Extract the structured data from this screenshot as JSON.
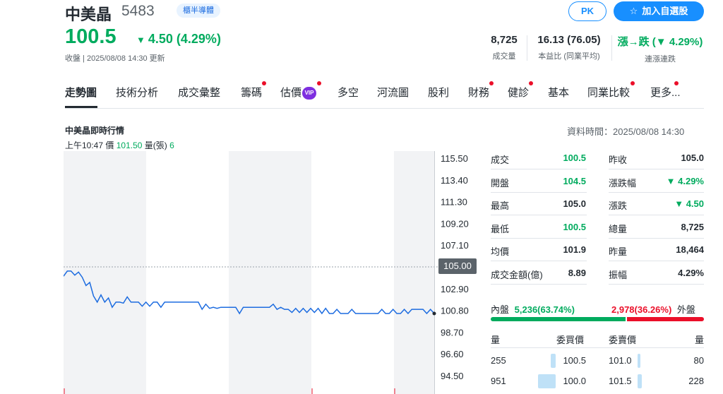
{
  "header": {
    "name": "中美晶",
    "code": "5483",
    "badge": "櫃半導體",
    "price": "100.5",
    "change_arrow": "▼",
    "change": "4.50 (4.29%)",
    "update_time": "收盤 | 2025/08/08 14:30 更新",
    "stats": [
      {
        "value": "8,725",
        "label": "成交量"
      },
      {
        "value": "16.13 (76.05)",
        "label": "本益比 (同業平均)"
      },
      {
        "value": "漲→跌 (▼ 4.29%)",
        "label": "連漲連跌"
      }
    ],
    "pk_label": "PK",
    "watch_icon": "☆",
    "watch_label": "加入自選股"
  },
  "tabs": [
    {
      "label": "走勢圖",
      "active": true,
      "dot": false
    },
    {
      "label": "技術分析",
      "dot": false
    },
    {
      "label": "成交彙整",
      "dot": false
    },
    {
      "label": "籌碼",
      "dot": true
    },
    {
      "label": "估價",
      "vip": "VIP",
      "dot": true
    },
    {
      "label": "多空",
      "dot": false
    },
    {
      "label": "河流圖",
      "dot": false
    },
    {
      "label": "股利",
      "dot": false
    },
    {
      "label": "財務",
      "dot": true
    },
    {
      "label": "健診",
      "dot": true
    },
    {
      "label": "基本",
      "dot": false
    },
    {
      "label": "同業比較",
      "dot": true
    },
    {
      "label": "更多...",
      "dot": true
    }
  ],
  "realtime": {
    "title": "中美晶即時行情",
    "time_label": "上午10:47",
    "price_label": "價",
    "price_value": "101.50",
    "volume_label": "量(張)",
    "volume_value": "6",
    "data_time": "資料時間：2025/08/08 14:30"
  },
  "chart_data": {
    "type": "line",
    "yticks": [
      "115.50",
      "113.40",
      "111.30",
      "109.20",
      "107.10",
      "105.00",
      "102.90",
      "100.80",
      "98.70",
      "96.60",
      "94.50"
    ],
    "ylim": [
      94.5,
      115.5
    ],
    "reference_price": "105.00",
    "series": [
      {
        "values": [
          104.1,
          104.6,
          104.6,
          104.2,
          104.5,
          104.0,
          103.2,
          103.5,
          102.2,
          101.6,
          102.3,
          101.6,
          102.0,
          101.1,
          101.6,
          101.6,
          101.5,
          102.1,
          101.6,
          101.6,
          101.6,
          101.2,
          101.6,
          101.2,
          101.6,
          101.6,
          101.1,
          101.6,
          101.6,
          101.6,
          101.6,
          101.6,
          101.6,
          101.6,
          101.6,
          101.6,
          101.6,
          100.9,
          101.4,
          101.0,
          101.1,
          101.0,
          101.1,
          101.1,
          101.1,
          101.1,
          101.1,
          100.5,
          101.1,
          101.1,
          101.1,
          101.1,
          101.1,
          101.1,
          101.1,
          101.1,
          101.4,
          100.9,
          101.1,
          100.9,
          100.9,
          100.6,
          101.0,
          100.6,
          101.0,
          100.6,
          101.0,
          100.6,
          101.0,
          100.5,
          101.0,
          100.5,
          100.5,
          100.9,
          100.5,
          100.5,
          100.5,
          100.9,
          100.5,
          100.5,
          100.5,
          100.5,
          100.5,
          100.5,
          100.5,
          100.9,
          100.5,
          100.5,
          100.9,
          100.5,
          100.5,
          100.9,
          100.5,
          100.9,
          100.9,
          100.9,
          100.9,
          100.5,
          100.9,
          100.5
        ]
      }
    ]
  },
  "quote": {
    "left": [
      {
        "label": "成交",
        "value": "100.5",
        "color": "#00ab5e"
      },
      {
        "label": "開盤",
        "value": "104.5",
        "color": "#00ab5e"
      },
      {
        "label": "最高",
        "value": "105.0",
        "color": "#232a31"
      },
      {
        "label": "最低",
        "value": "100.5",
        "color": "#00ab5e"
      },
      {
        "label": "均價",
        "value": "101.9",
        "color": "#232a31"
      },
      {
        "label": "成交金額(億)",
        "value": "8.89",
        "color": "#232a31"
      }
    ],
    "right": [
      {
        "label": "昨收",
        "value": "105.0",
        "color": "#232a31"
      },
      {
        "label": "漲跌幅",
        "value": "▼ 4.29%",
        "color": "#00ab5e"
      },
      {
        "label": "漲跌",
        "value": "▼ 4.50",
        "color": "#00ab5e"
      },
      {
        "label": "總量",
        "value": "8,725",
        "color": "#232a31"
      },
      {
        "label": "昨量",
        "value": "18,464",
        "color": "#232a31"
      },
      {
        "label": "振幅",
        "value": "4.29%",
        "color": "#232a31"
      }
    ]
  },
  "inout": {
    "in_label": "內盤",
    "in_value": "5,236(63.74%)",
    "out_value": "2,978(36.26%)",
    "out_label": "外盤",
    "in_fraction": 0.6374
  },
  "orderbook": {
    "headers": [
      "量",
      "委買價",
      "委賣價",
      "量"
    ],
    "rows": [
      {
        "bid_vol": "255",
        "bid": "100.5",
        "ask": "101.0",
        "ask_vol": "80",
        "bid_frac": 0.27,
        "ask_frac": 0.08
      },
      {
        "bid_vol": "951",
        "bid": "100.0",
        "ask": "101.5",
        "ask_vol": "228",
        "bid_frac": 1.0,
        "ask_frac": 0.24
      }
    ]
  },
  "colors": {
    "up": "#eb0f29",
    "down": "#00ab5e",
    "accent": "#188fff",
    "line": "#1d6ce0"
  }
}
